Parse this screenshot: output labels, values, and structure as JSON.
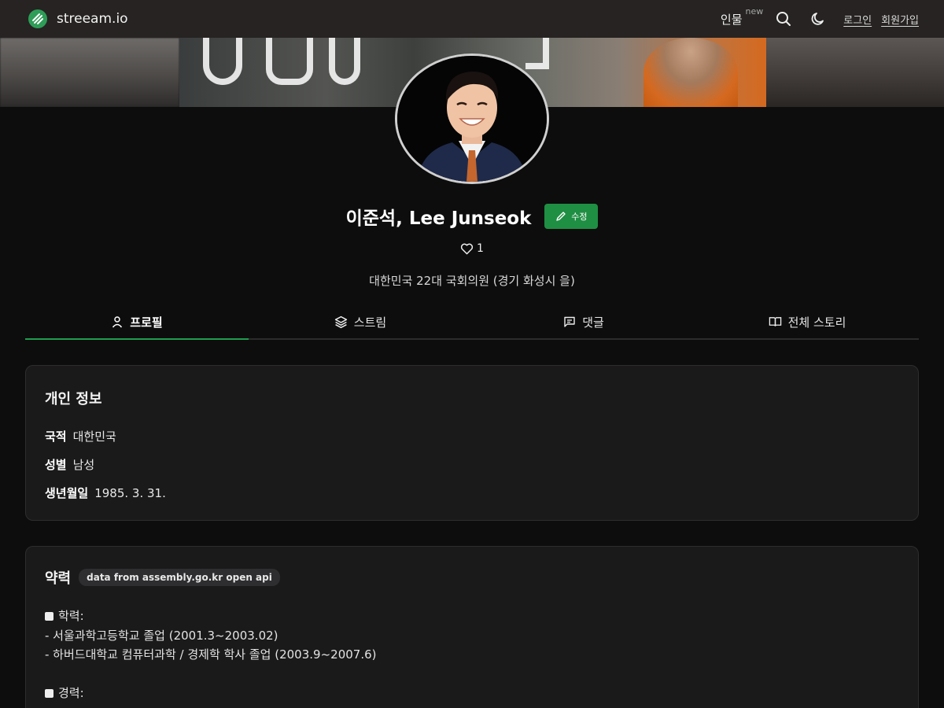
{
  "header": {
    "logo_text": "streeam.io",
    "nav_people": "인물",
    "nav_people_badge": "new",
    "login": "로그인",
    "signup": "회원가입"
  },
  "profile": {
    "name": "이준석, Lee Junseok",
    "edit_label": "수정",
    "likes": "1",
    "subtitle": "대한민국 22대 국회의원 (경기 화성시 을)"
  },
  "tabs": [
    {
      "label": "프로필",
      "icon": "user-icon",
      "active": true
    },
    {
      "label": "스트림",
      "icon": "layers-icon",
      "active": false
    },
    {
      "label": "댓글",
      "icon": "comment-icon",
      "active": false
    },
    {
      "label": "전체 스토리",
      "icon": "book-icon",
      "active": false
    }
  ],
  "personal": {
    "title": "개인 정보",
    "rows": [
      {
        "label": "국적",
        "value": "대한민국"
      },
      {
        "label": "성별",
        "value": "남성"
      },
      {
        "label": "생년월일",
        "value": "1985. 3. 31."
      }
    ]
  },
  "career": {
    "title": "약력",
    "badge": "data from assembly.go.kr open api",
    "education_heading": "학력:",
    "education": [
      "- 서울과학고등학교 졸업 (2001.3~2003.02)",
      "- 하버드대학교 컴퓨터과학 / 경제학 학사 졸업 (2003.9~2007.6)"
    ],
    "career_heading": "경력:"
  },
  "colors": {
    "accent": "#1f8f43",
    "tab_underline": "#1e9e4e",
    "background": "#0d0d0d",
    "topbar": "#262322",
    "card": "#1b1a1a"
  }
}
